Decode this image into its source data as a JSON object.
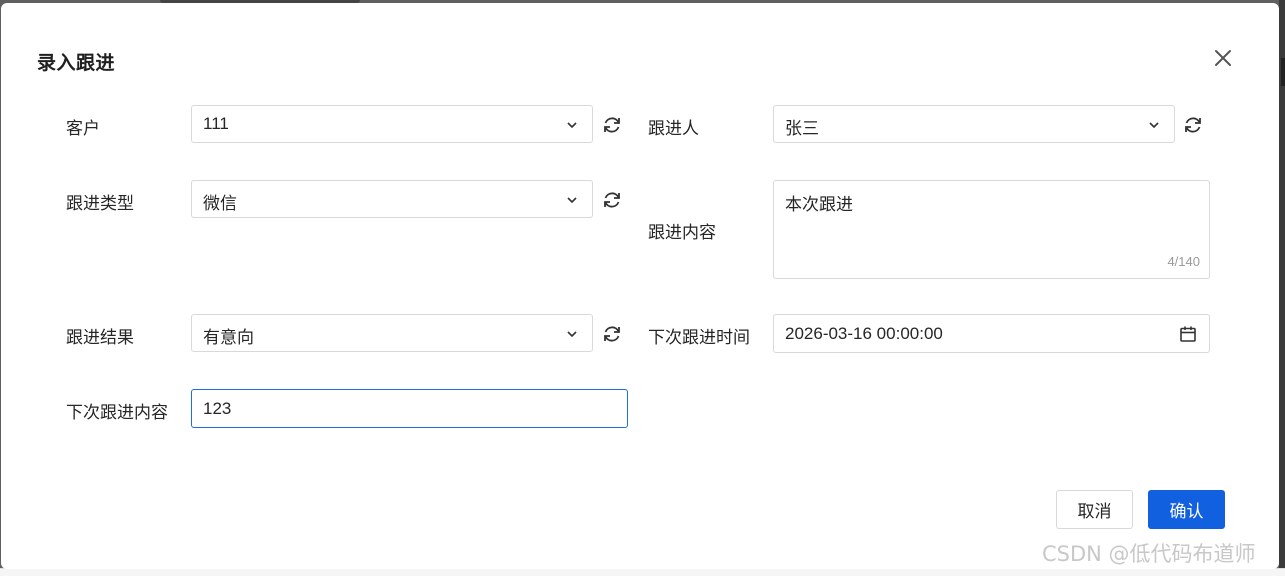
{
  "dialog": {
    "title": "录入跟进",
    "close_icon": "close-icon"
  },
  "form": {
    "customer": {
      "label": "客户",
      "value": "111"
    },
    "follower": {
      "label": "跟进人",
      "value": "张三"
    },
    "follow_type": {
      "label": "跟进类型",
      "value": "微信"
    },
    "follow_content": {
      "label": "跟进内容",
      "value": "本次跟进",
      "counter": "4/140"
    },
    "follow_result": {
      "label": "跟进结果",
      "value": "有意向"
    },
    "next_time": {
      "label": "下次跟进时间",
      "value": "2026-03-16 00:00:00"
    },
    "next_content": {
      "label": "下次跟进内容",
      "value": "123"
    }
  },
  "footer": {
    "cancel_label": "取消",
    "confirm_label": "确认"
  },
  "watermark": "CSDN @低代码布道师",
  "colors": {
    "primary": "#1060e0",
    "focus_border": "#1e6fd9",
    "border": "#d9d9d9"
  }
}
